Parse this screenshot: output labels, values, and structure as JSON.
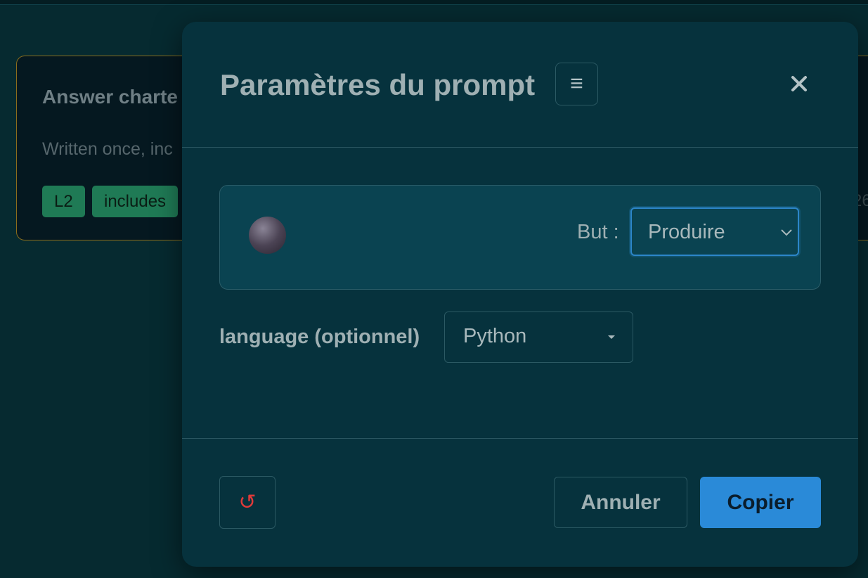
{
  "background_card": {
    "title": "Answer charte",
    "description": "Written once, inc",
    "tags": [
      "L2",
      "includes"
    ],
    "right_text": "26"
  },
  "modal": {
    "title": "Paramètres du prompt",
    "menu_icon": "≡",
    "close_icon": "×",
    "purpose": {
      "label": "But :",
      "value": "Produire"
    },
    "language": {
      "label": "language (optionnel)",
      "value": "Python"
    },
    "reset_icon": "↺",
    "cancel_label": "Annuler",
    "copy_label": "Copier"
  },
  "colors": {
    "page_bg": "#062a30",
    "modal_bg": "#06323d",
    "accent": "#2a8ad8",
    "reset_red": "#e03a3a"
  }
}
